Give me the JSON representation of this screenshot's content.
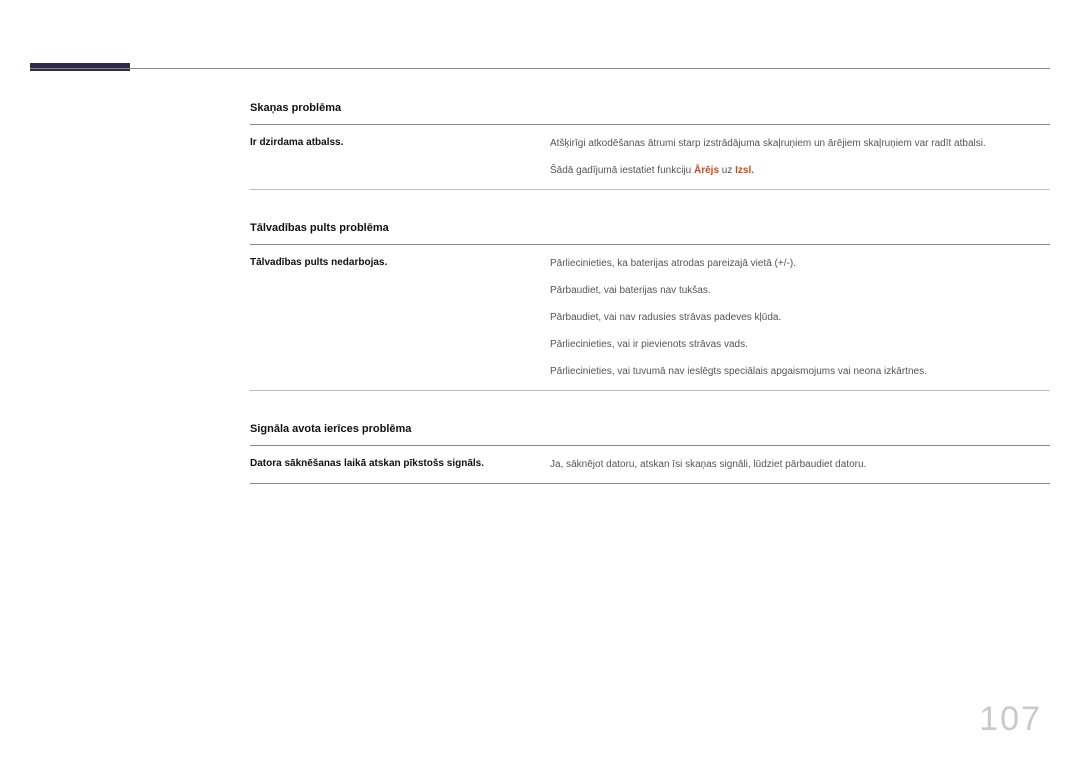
{
  "page_number": "107",
  "sections": [
    {
      "header": "Skaņas problēma",
      "rows": [
        {
          "left": "Ir dzirdama atbalss.",
          "paragraphs": [
            {
              "segments": [
                {
                  "t": "Atšķirīgi atkodēšanas ātrumi starp izstrādājuma skaļruņiem un ārējiem skaļruņiem var radīt atbalsi."
                }
              ]
            },
            {
              "segments": [
                {
                  "t": "Šādā gadījumā iestatiet funkciju "
                },
                {
                  "t": "Ārējs",
                  "hl": true
                },
                {
                  "t": " uz "
                },
                {
                  "t": "Izsl.",
                  "hl": true
                }
              ]
            }
          ]
        }
      ]
    },
    {
      "header": "Tālvadības pults problēma",
      "rows": [
        {
          "left": "Tālvadības pults nedarbojas.",
          "paragraphs": [
            {
              "segments": [
                {
                  "t": "Pārliecinieties, ka baterijas atrodas pareizajā vietā (+/-)."
                }
              ]
            },
            {
              "segments": [
                {
                  "t": "Pārbaudiet, vai baterijas nav tukšas."
                }
              ]
            },
            {
              "segments": [
                {
                  "t": "Pārbaudiet, vai nav radusies strāvas padeves kļūda."
                }
              ]
            },
            {
              "segments": [
                {
                  "t": "Pārliecinieties, vai ir pievienots strāvas vads."
                }
              ]
            },
            {
              "segments": [
                {
                  "t": "Pārliecinieties, vai tuvumā nav ieslēgts speciālais apgaismojums vai neona izkārtnes."
                }
              ]
            }
          ]
        }
      ]
    },
    {
      "header": "Signāla avota ierīces problēma",
      "rows": [
        {
          "left": "Datora sāknēšanas laikā atskan pīkstošs signāls.",
          "paragraphs": [
            {
              "segments": [
                {
                  "t": "Ja, sāknējot datoru, atskan īsi skaņas signāli, lūdziet pārbaudiet datoru."
                }
              ]
            }
          ]
        }
      ]
    }
  ]
}
